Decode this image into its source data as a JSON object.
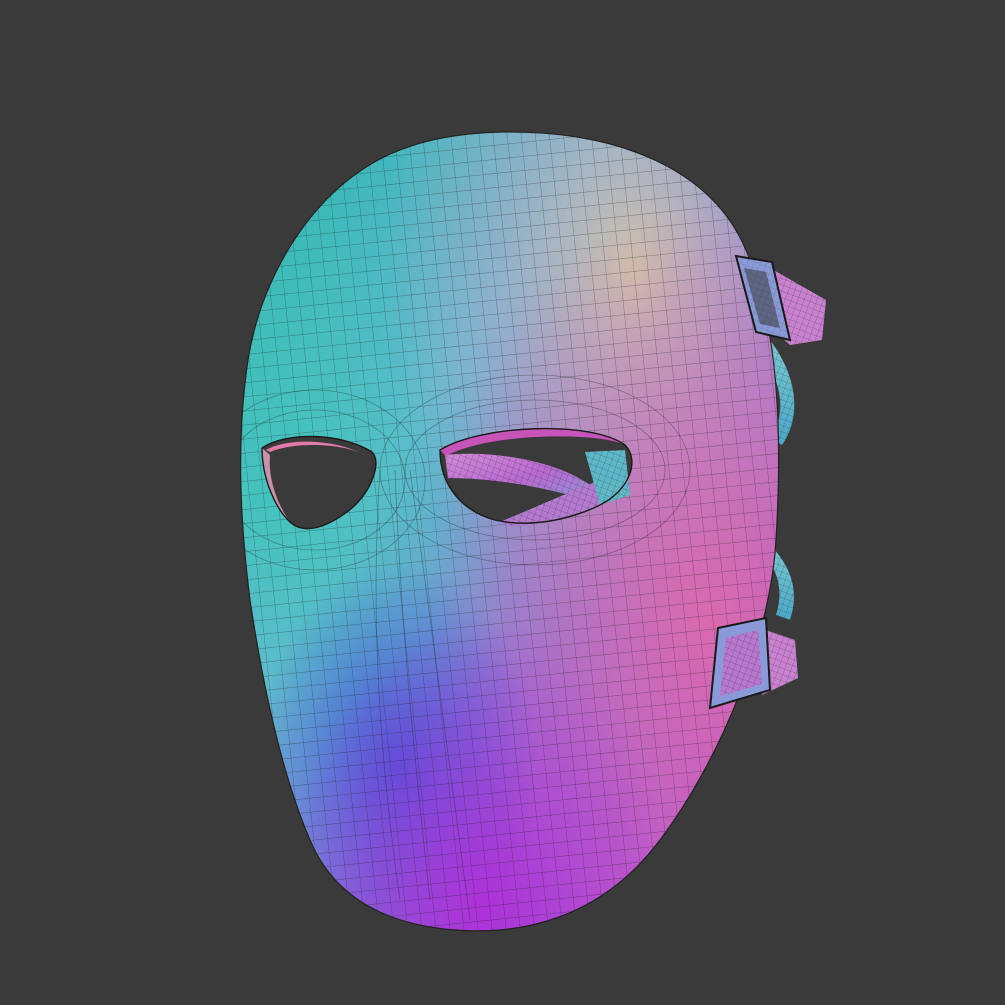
{
  "viewport": {
    "background": "#3a3a3a",
    "object": "mask",
    "shading": "normal-map",
    "display": "wireframe-overlay"
  },
  "colors": {
    "teal": "#1fb8a6",
    "cyan": "#5fc6d8",
    "blue": "#4a66d6",
    "violet": "#9a5ad8",
    "magenta": "#d650c8",
    "pink": "#e07aa8",
    "wire": "#1a1a1a"
  },
  "parts": [
    "mask-shell",
    "left-eye-hole",
    "right-eye-hole",
    "upper-strap",
    "lower-strap",
    "upper-buckle",
    "lower-buckle"
  ]
}
